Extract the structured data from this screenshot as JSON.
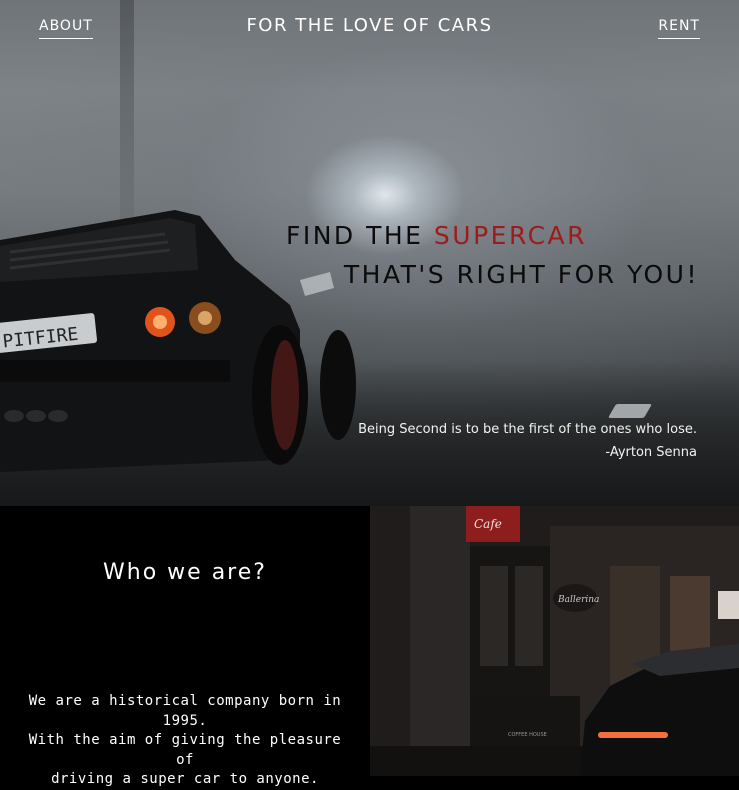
{
  "nav": {
    "about_label": "ABOUT",
    "title": "FOR THE LOVE OF CARS",
    "rent_label": "RENT"
  },
  "hero": {
    "headline_part1": "FIND THE ",
    "headline_accent": "SUPERCAR",
    "headline_line2": "THAT'S RIGHT FOR YOU!",
    "quote_text": "Being Second is to be the first of the ones who lose.",
    "quote_author": "-Ayrton Senna",
    "plate_text": "PITFIRE",
    "accent_color": "#9e1b1b"
  },
  "about": {
    "title": "Who we are?",
    "line1": "We are a historical company born in",
    "line2": "1995.",
    "line3": "With the aim of giving the pleasure of",
    "line4": "driving a super car to anyone."
  },
  "street": {
    "sign_text": "Cafe",
    "shop_text": "Ballerina",
    "awning_text": "COFFEE HOUSE"
  }
}
